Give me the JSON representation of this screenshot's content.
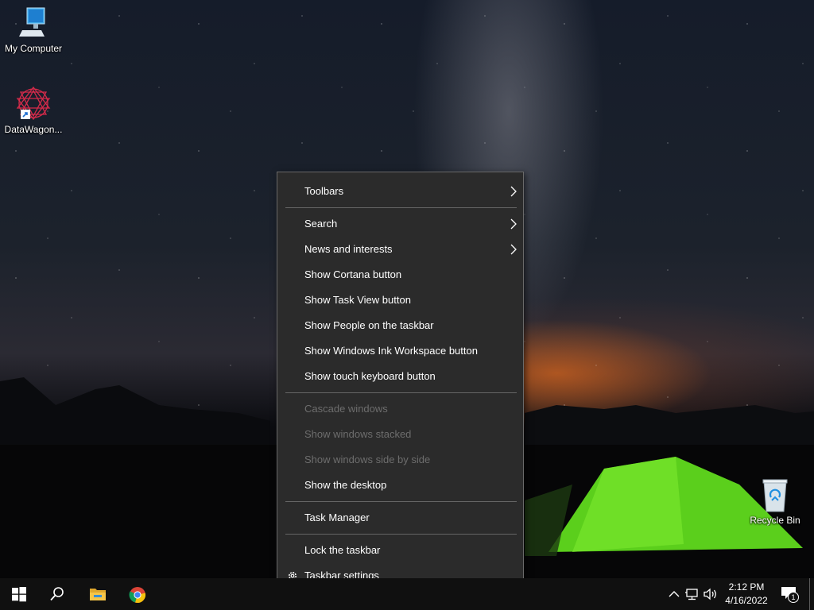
{
  "desktop": {
    "icons": [
      {
        "label": "My Computer",
        "icon": "computer-icon"
      },
      {
        "label": "DataWagon...",
        "icon": "datawagon-shortcut-icon"
      },
      {
        "label": "Recycle Bin",
        "icon": "recycle-bin-icon"
      }
    ]
  },
  "context_menu": {
    "items": [
      {
        "label": "Toolbars",
        "submenu": true,
        "enabled": true
      },
      {
        "label": "Search",
        "submenu": true,
        "enabled": true
      },
      {
        "label": "News and interests",
        "submenu": true,
        "enabled": true
      },
      {
        "label": "Show Cortana button",
        "enabled": true
      },
      {
        "label": "Show Task View button",
        "enabled": true
      },
      {
        "label": "Show People on the taskbar",
        "enabled": true
      },
      {
        "label": "Show Windows Ink Workspace button",
        "enabled": true
      },
      {
        "label": "Show touch keyboard button",
        "enabled": true
      },
      {
        "label": "Cascade windows",
        "enabled": false
      },
      {
        "label": "Show windows stacked",
        "enabled": false
      },
      {
        "label": "Show windows side by side",
        "enabled": false
      },
      {
        "label": "Show the desktop",
        "enabled": true
      },
      {
        "label": "Task Manager",
        "enabled": true
      },
      {
        "label": "Lock the taskbar",
        "enabled": true
      },
      {
        "label": "Taskbar settings",
        "icon": "gear-icon",
        "enabled": true
      }
    ]
  },
  "taskbar": {
    "buttons": [
      "start-icon",
      "search-icon",
      "file-explorer-icon",
      "chrome-icon"
    ],
    "tray": {
      "time": "2:12 PM",
      "date": "4/16/2022",
      "notification_count": "1"
    }
  },
  "colors": {
    "menu_bg": "#2b2b2b",
    "menu_border": "#6a6a6a",
    "disabled_text": "#6d6d6d",
    "taskbar_bg": "#101010"
  }
}
